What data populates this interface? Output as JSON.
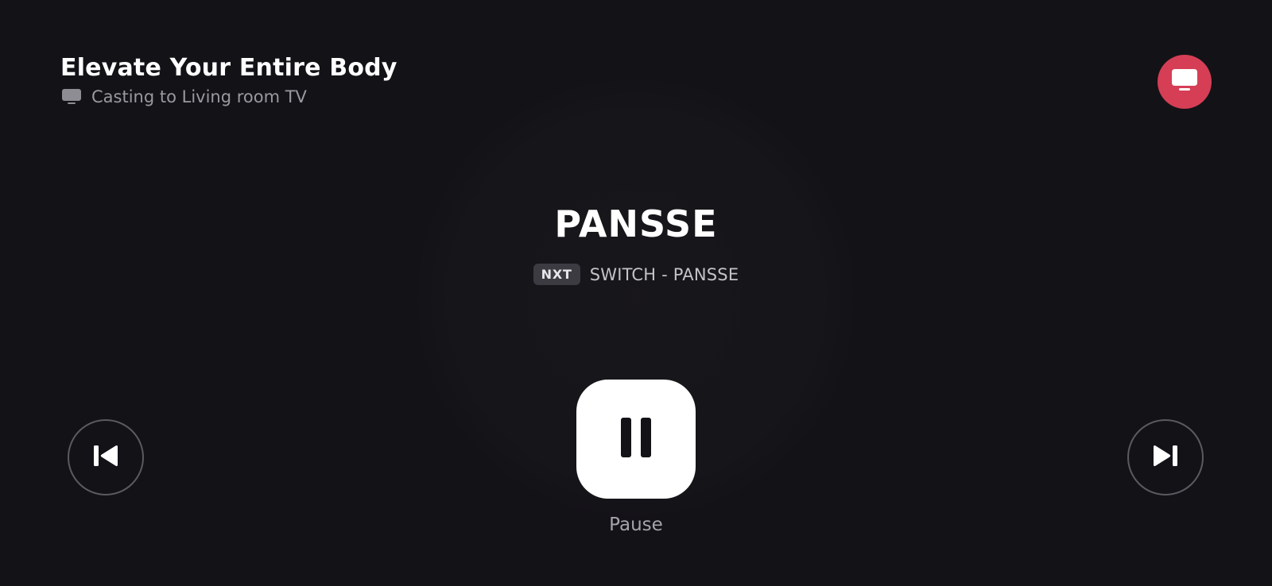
{
  "header": {
    "workout_title": "Elevate Your Entire Body",
    "casting_status": "Casting to Living room TV",
    "casting_icon": "tv-icon"
  },
  "cast_button": {
    "icon": "tv-icon",
    "color": "#d53e55"
  },
  "current_exercise": {
    "name": "PANSSE"
  },
  "next_exercise": {
    "badge": "NXT",
    "name": "SWITCH - PANSSE"
  },
  "controls": {
    "pause_label": "Pause",
    "pause_icon": "pause-icon",
    "previous_icon": "skip-previous-icon",
    "next_icon": "skip-next-icon"
  },
  "colors": {
    "background": "#131217",
    "accent": "#d53e55"
  }
}
